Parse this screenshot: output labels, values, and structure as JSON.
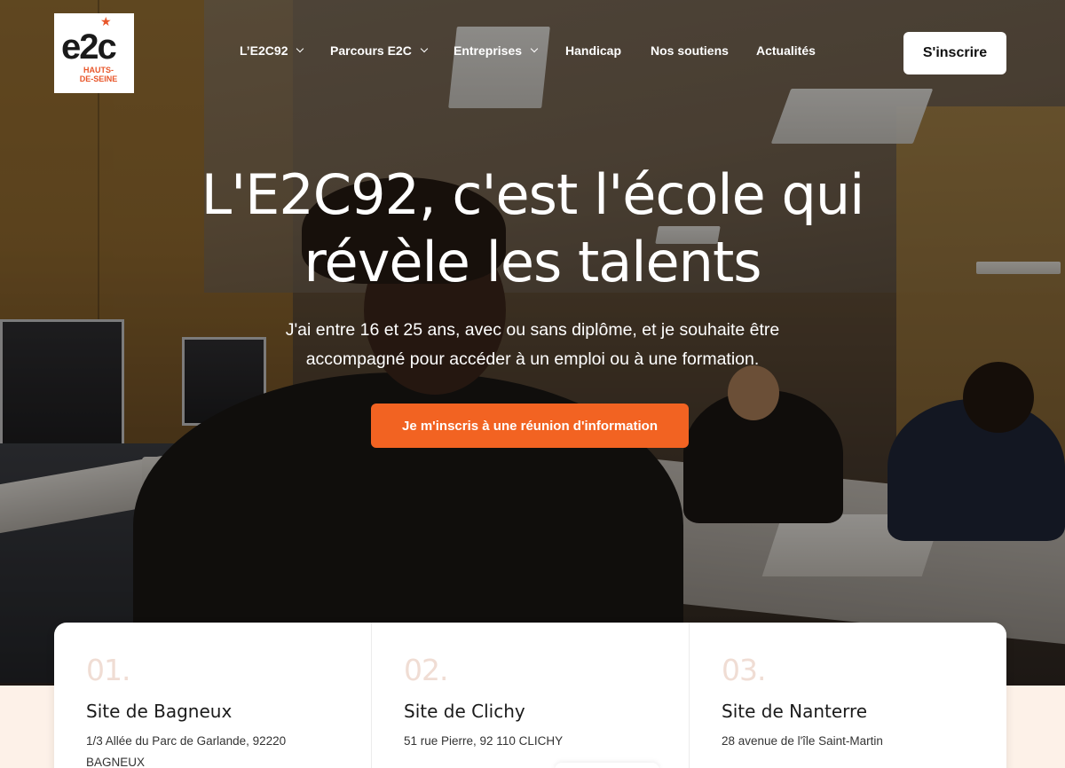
{
  "header": {
    "logo": {
      "main": "e2c",
      "sub_line1": "HAUTS-",
      "sub_line2": "DE-SEINE"
    },
    "nav": [
      {
        "label": "L’E2C92",
        "dropdown": true
      },
      {
        "label": "Parcours E2C",
        "dropdown": true
      },
      {
        "label": "Entreprises",
        "dropdown": true
      },
      {
        "label": "Handicap",
        "dropdown": false
      },
      {
        "label": "Nos soutiens",
        "dropdown": false
      },
      {
        "label": "Actualités",
        "dropdown": false
      }
    ],
    "signup_label": "S'inscrire"
  },
  "hero": {
    "title_line1": "L'E2C92, c'est l'école qui",
    "title_line2": "révèle les talents",
    "subtitle_line1": "J'ai entre 16 et 25 ans, avec ou sans diplôme, et je souhaite être",
    "subtitle_line2": "accompagné pour accéder à un emploi ou à une formation.",
    "cta_label": "Je m'inscris à une réunion d'information",
    "cta_color": "#f26322"
  },
  "sites": [
    {
      "number": "01.",
      "name": "Site de Bagneux",
      "address": "1/3 Allée du Parc de Garlande, 92220 BAGNEUX"
    },
    {
      "number": "02.",
      "name": "Site de Clichy",
      "address": "51 rue Pierre, 92 110 CLICHY"
    },
    {
      "number": "03.",
      "name": "Site de Nanterre",
      "address": "28 avenue de l'île Saint-Martin"
    }
  ]
}
